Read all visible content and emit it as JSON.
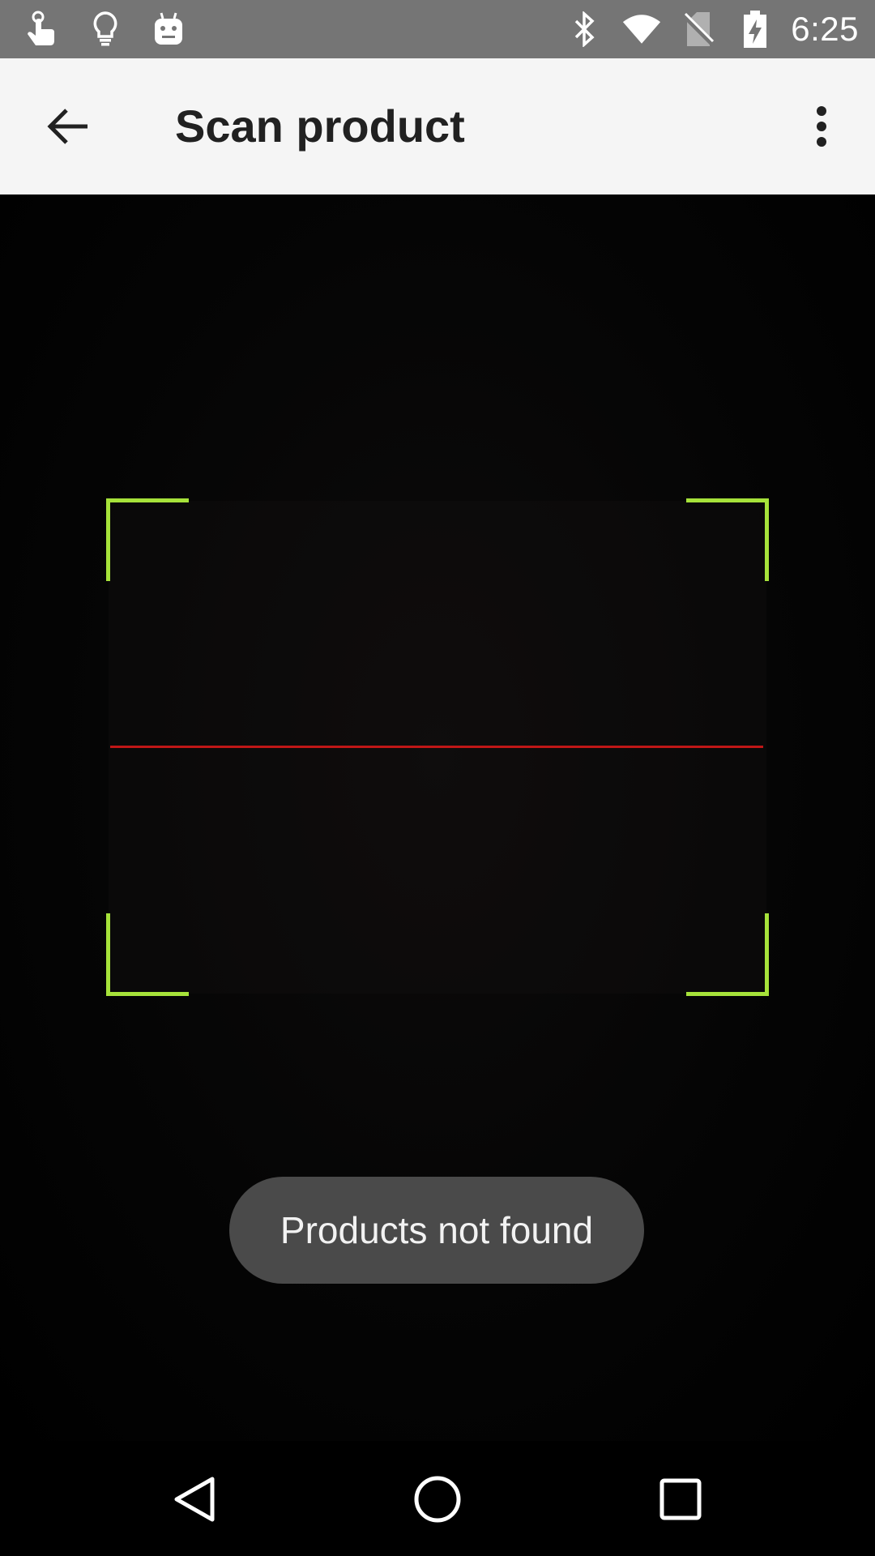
{
  "status_bar": {
    "time": "6:25",
    "left_icons": [
      "touch-gesture-icon",
      "lightbulb-icon",
      "android-robot-icon"
    ],
    "right_icons": [
      "bluetooth-icon",
      "wifi-icon",
      "no-sim-icon",
      "battery-charging-icon"
    ]
  },
  "app_bar": {
    "title": "Scan product",
    "back_icon": "arrow-back-icon",
    "menu_icon": "more-vert-icon"
  },
  "scanner": {
    "frame_color": "#a6e23a",
    "laser_color": "#c01616"
  },
  "toast": {
    "message": "Products not found"
  },
  "nav_bar": {
    "icons": [
      "nav-back-icon",
      "nav-home-icon",
      "nav-recents-icon"
    ]
  }
}
